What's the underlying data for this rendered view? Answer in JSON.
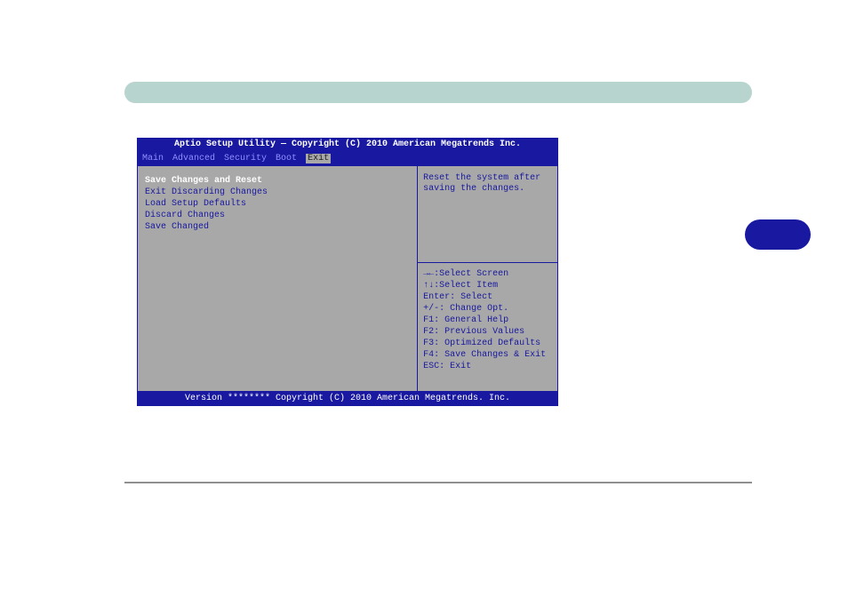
{
  "bios": {
    "header": "Aptio Setup Utility — Copyright (C) 2010 American Megatrends Inc.",
    "tabs": {
      "main": "Main",
      "advanced": "Advanced",
      "security": "Security",
      "boot": "Boot",
      "exit": "Exit"
    },
    "menu": {
      "save_reset": "Save Changes and Reset",
      "exit_discard": "Exit Discarding Changes",
      "load_defaults": "Load Setup Defaults",
      "discard": "Discard Changes",
      "save_changed": "Save Changed"
    },
    "desc": "Reset the system after saving the changes.",
    "keys": {
      "select_screen": "→←:Select Screen",
      "select_item": "↑↓:Select Item",
      "enter": "Enter: Select",
      "change": "+/-: Change Opt.",
      "f1": "F1: General Help",
      "f2": "F2: Previous Values",
      "f3": "F3: Optimized Defaults",
      "f4": "F4: Save Changes & Exit",
      "esc": "ESC: Exit"
    },
    "footer": "Version ******** Copyright (C) 2010 American Megatrends. Inc."
  }
}
